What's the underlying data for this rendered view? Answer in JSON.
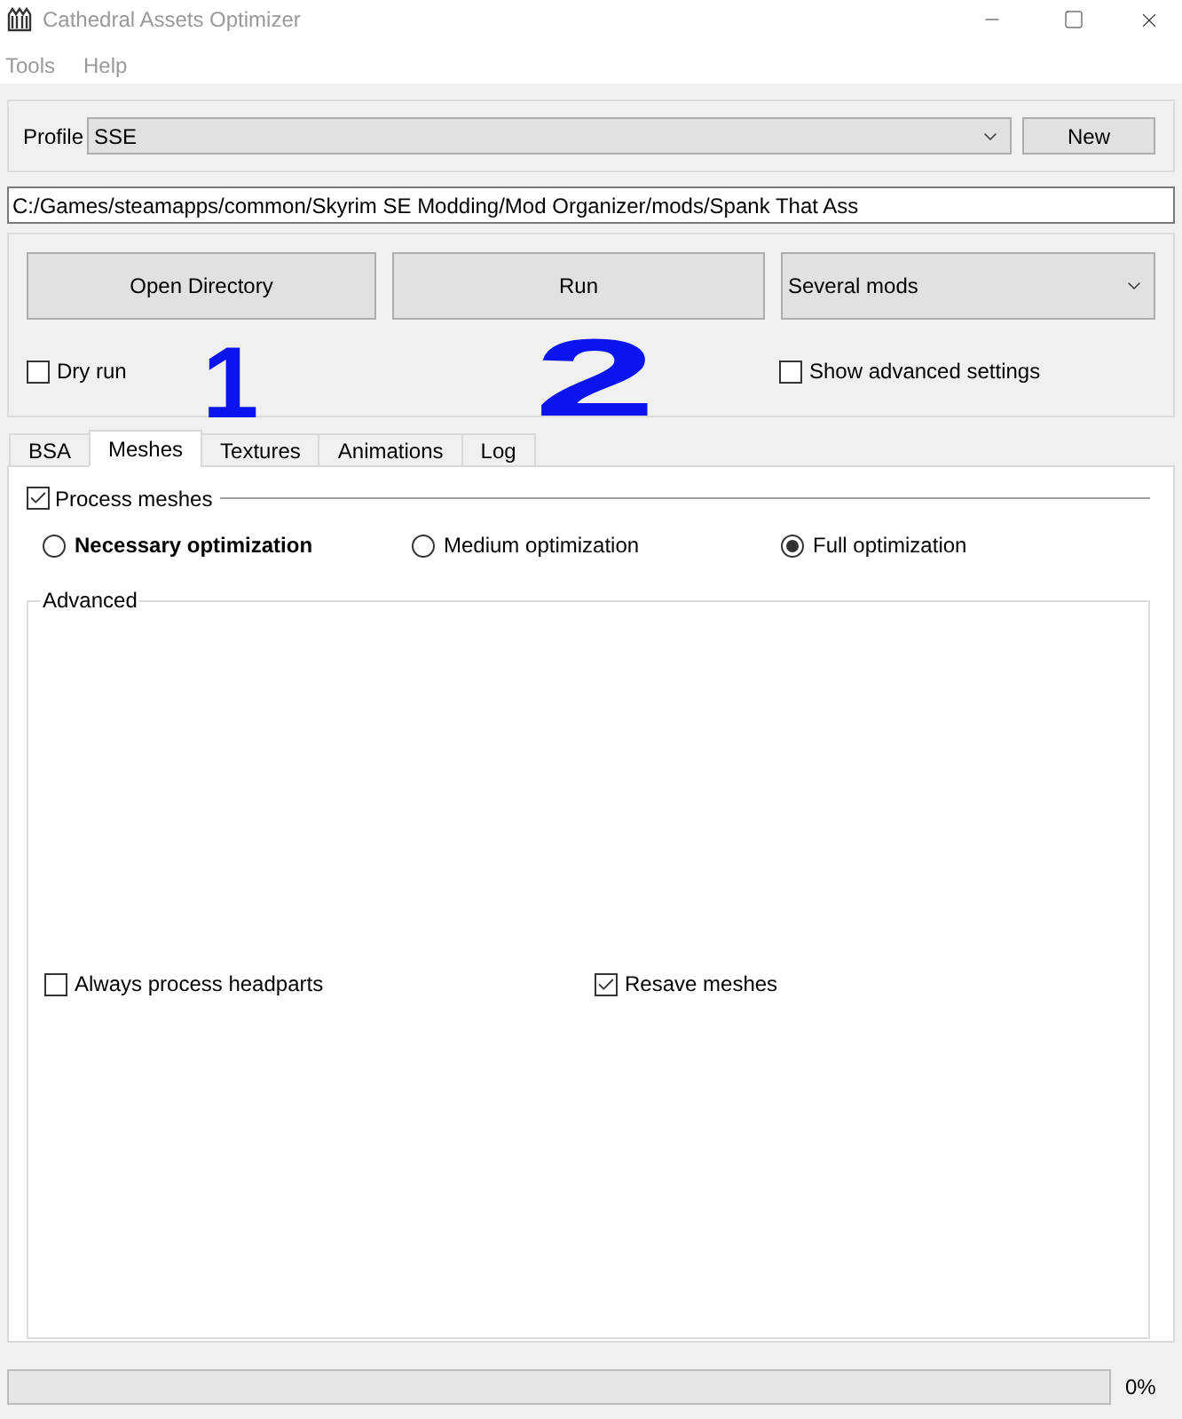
{
  "window": {
    "title": "Cathedral Assets Optimizer"
  },
  "menu": [
    {
      "label": "Tools"
    },
    {
      "label": "Help"
    }
  ],
  "profile": {
    "label": "Profile",
    "value": "SSE",
    "button": "New"
  },
  "path_field": {
    "value": "C:/Games/steamapps/common/Skyrim SE Modding/Mod Organizer/mods/Spank That Ass"
  },
  "actions": {
    "buttons": [
      {
        "label": "Open Directory"
      },
      {
        "label": "Run"
      }
    ],
    "mode_select": {
      "value": "Several mods"
    }
  },
  "options": [
    {
      "label": "Dry run",
      "checked": false
    },
    {
      "label": "Show advanced settings",
      "checked": false
    }
  ],
  "annotations": [
    {
      "text": "1"
    },
    {
      "text": "2"
    }
  ],
  "tabs": [
    {
      "label": "BSA",
      "selected": false
    },
    {
      "label": "Meshes",
      "selected": true
    },
    {
      "label": "Textures",
      "selected": false
    },
    {
      "label": "Animations",
      "selected": false
    },
    {
      "label": "Log",
      "selected": false
    }
  ],
  "meshes": {
    "process": {
      "label": "Process meshes",
      "checked": true
    },
    "levels": [
      {
        "label": "Necessary optimization",
        "selected": false,
        "emphasized": true
      },
      {
        "label": "Medium optimization",
        "selected": false,
        "emphasized": false
      },
      {
        "label": "Full optimization",
        "selected": true,
        "emphasized": false
      }
    ],
    "advanced": {
      "title": "Advanced",
      "options": [
        {
          "label": "Always process headparts",
          "checked": false
        },
        {
          "label": "Resave meshes",
          "checked": true
        }
      ]
    }
  },
  "progress": {
    "level": 0,
    "reading": "0%"
  }
}
